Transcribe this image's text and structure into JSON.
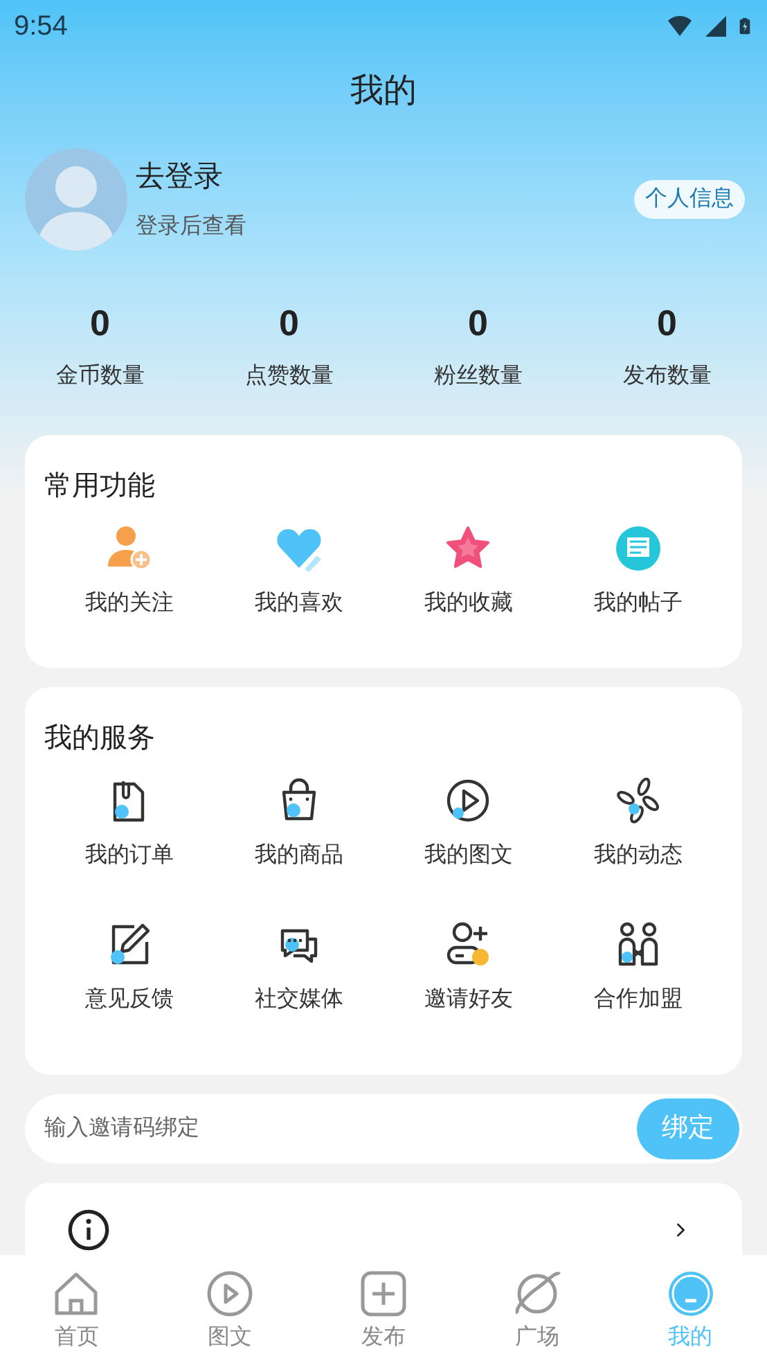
{
  "status_bar": {
    "time": "9:54"
  },
  "header": {
    "title": "我的"
  },
  "profile": {
    "name": "去登录",
    "subtitle": "登录后查看",
    "info_button": "个人信息"
  },
  "stats": [
    {
      "value": "0",
      "label": "金币数量"
    },
    {
      "value": "0",
      "label": "点赞数量"
    },
    {
      "value": "0",
      "label": "粉丝数量"
    },
    {
      "value": "0",
      "label": "发布数量"
    }
  ],
  "common_functions": {
    "title": "常用功能",
    "items": [
      {
        "kind": "follow",
        "label": "我的关注"
      },
      {
        "kind": "like",
        "label": "我的喜欢"
      },
      {
        "kind": "favorite",
        "label": "我的收藏"
      },
      {
        "kind": "post",
        "label": "我的帖子"
      }
    ]
  },
  "services": {
    "title": "我的服务",
    "items": [
      {
        "kind": "order",
        "label": "我的订单"
      },
      {
        "kind": "goods",
        "label": "我的商品"
      },
      {
        "kind": "video",
        "label": "我的图文"
      },
      {
        "kind": "moments",
        "label": "我的动态"
      },
      {
        "kind": "feedback",
        "label": "意见反馈"
      },
      {
        "kind": "chat",
        "label": "社交媒体"
      },
      {
        "kind": "invite",
        "label": "邀请好友"
      },
      {
        "kind": "partner",
        "label": "合作加盟"
      }
    ]
  },
  "invite_code": {
    "placeholder": "输入邀请码绑定",
    "button": "绑定"
  },
  "tab_bar": [
    {
      "kind": "home",
      "label": "首页",
      "selected": false
    },
    {
      "kind": "play",
      "label": "图文",
      "selected": false
    },
    {
      "kind": "add",
      "label": "发布",
      "selected": false
    },
    {
      "kind": "planet",
      "label": "广场",
      "selected": false
    },
    {
      "kind": "me",
      "label": "我的",
      "selected": true
    }
  ]
}
